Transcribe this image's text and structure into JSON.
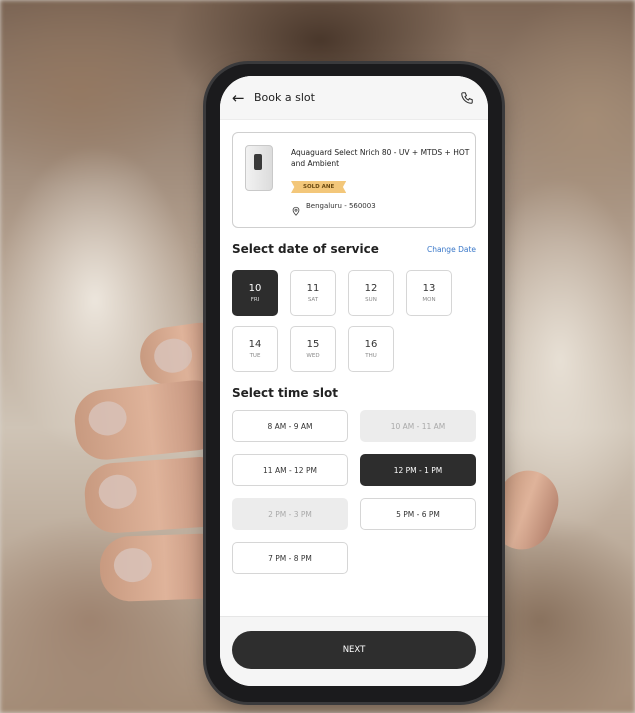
{
  "header": {
    "title": "Book a slot",
    "back_icon": "arrow-left-icon",
    "call_icon": "phone-icon"
  },
  "product": {
    "name": "Aquaguard Select Nrich 80 - UV + MTDS + HOT and Ambient",
    "badge": "SOLD ANE",
    "location": "Bengaluru - 560003",
    "location_icon": "location-pin-icon"
  },
  "date_section": {
    "title": "Select date of service",
    "change_label": "Change Date",
    "dates": [
      {
        "num": "10",
        "day": "FRI",
        "selected": true
      },
      {
        "num": "11",
        "day": "SAT",
        "selected": false
      },
      {
        "num": "12",
        "day": "SUN",
        "selected": false
      },
      {
        "num": "13",
        "day": "MON",
        "selected": false
      },
      {
        "num": "14",
        "day": "TUE",
        "selected": false
      },
      {
        "num": "15",
        "day": "WED",
        "selected": false
      },
      {
        "num": "16",
        "day": "THU",
        "selected": false
      }
    ]
  },
  "time_section": {
    "title": "Select time slot",
    "slots": [
      {
        "label": "8 AM - 9 AM",
        "state": "available"
      },
      {
        "label": "10 AM - 11 AM",
        "state": "disabled"
      },
      {
        "label": "11 AM - 12 PM",
        "state": "available"
      },
      {
        "label": "12 PM - 1 PM",
        "state": "selected"
      },
      {
        "label": "2 PM - 3 PM",
        "state": "disabled"
      },
      {
        "label": "5 PM - 6 PM",
        "state": "available"
      },
      {
        "label": "7 PM - 8 PM",
        "state": "available"
      }
    ]
  },
  "footer": {
    "next_label": "NEXT"
  },
  "colors": {
    "selected": "#2d2d2d",
    "link": "#3a78c9",
    "badge": "#f3c77a"
  }
}
